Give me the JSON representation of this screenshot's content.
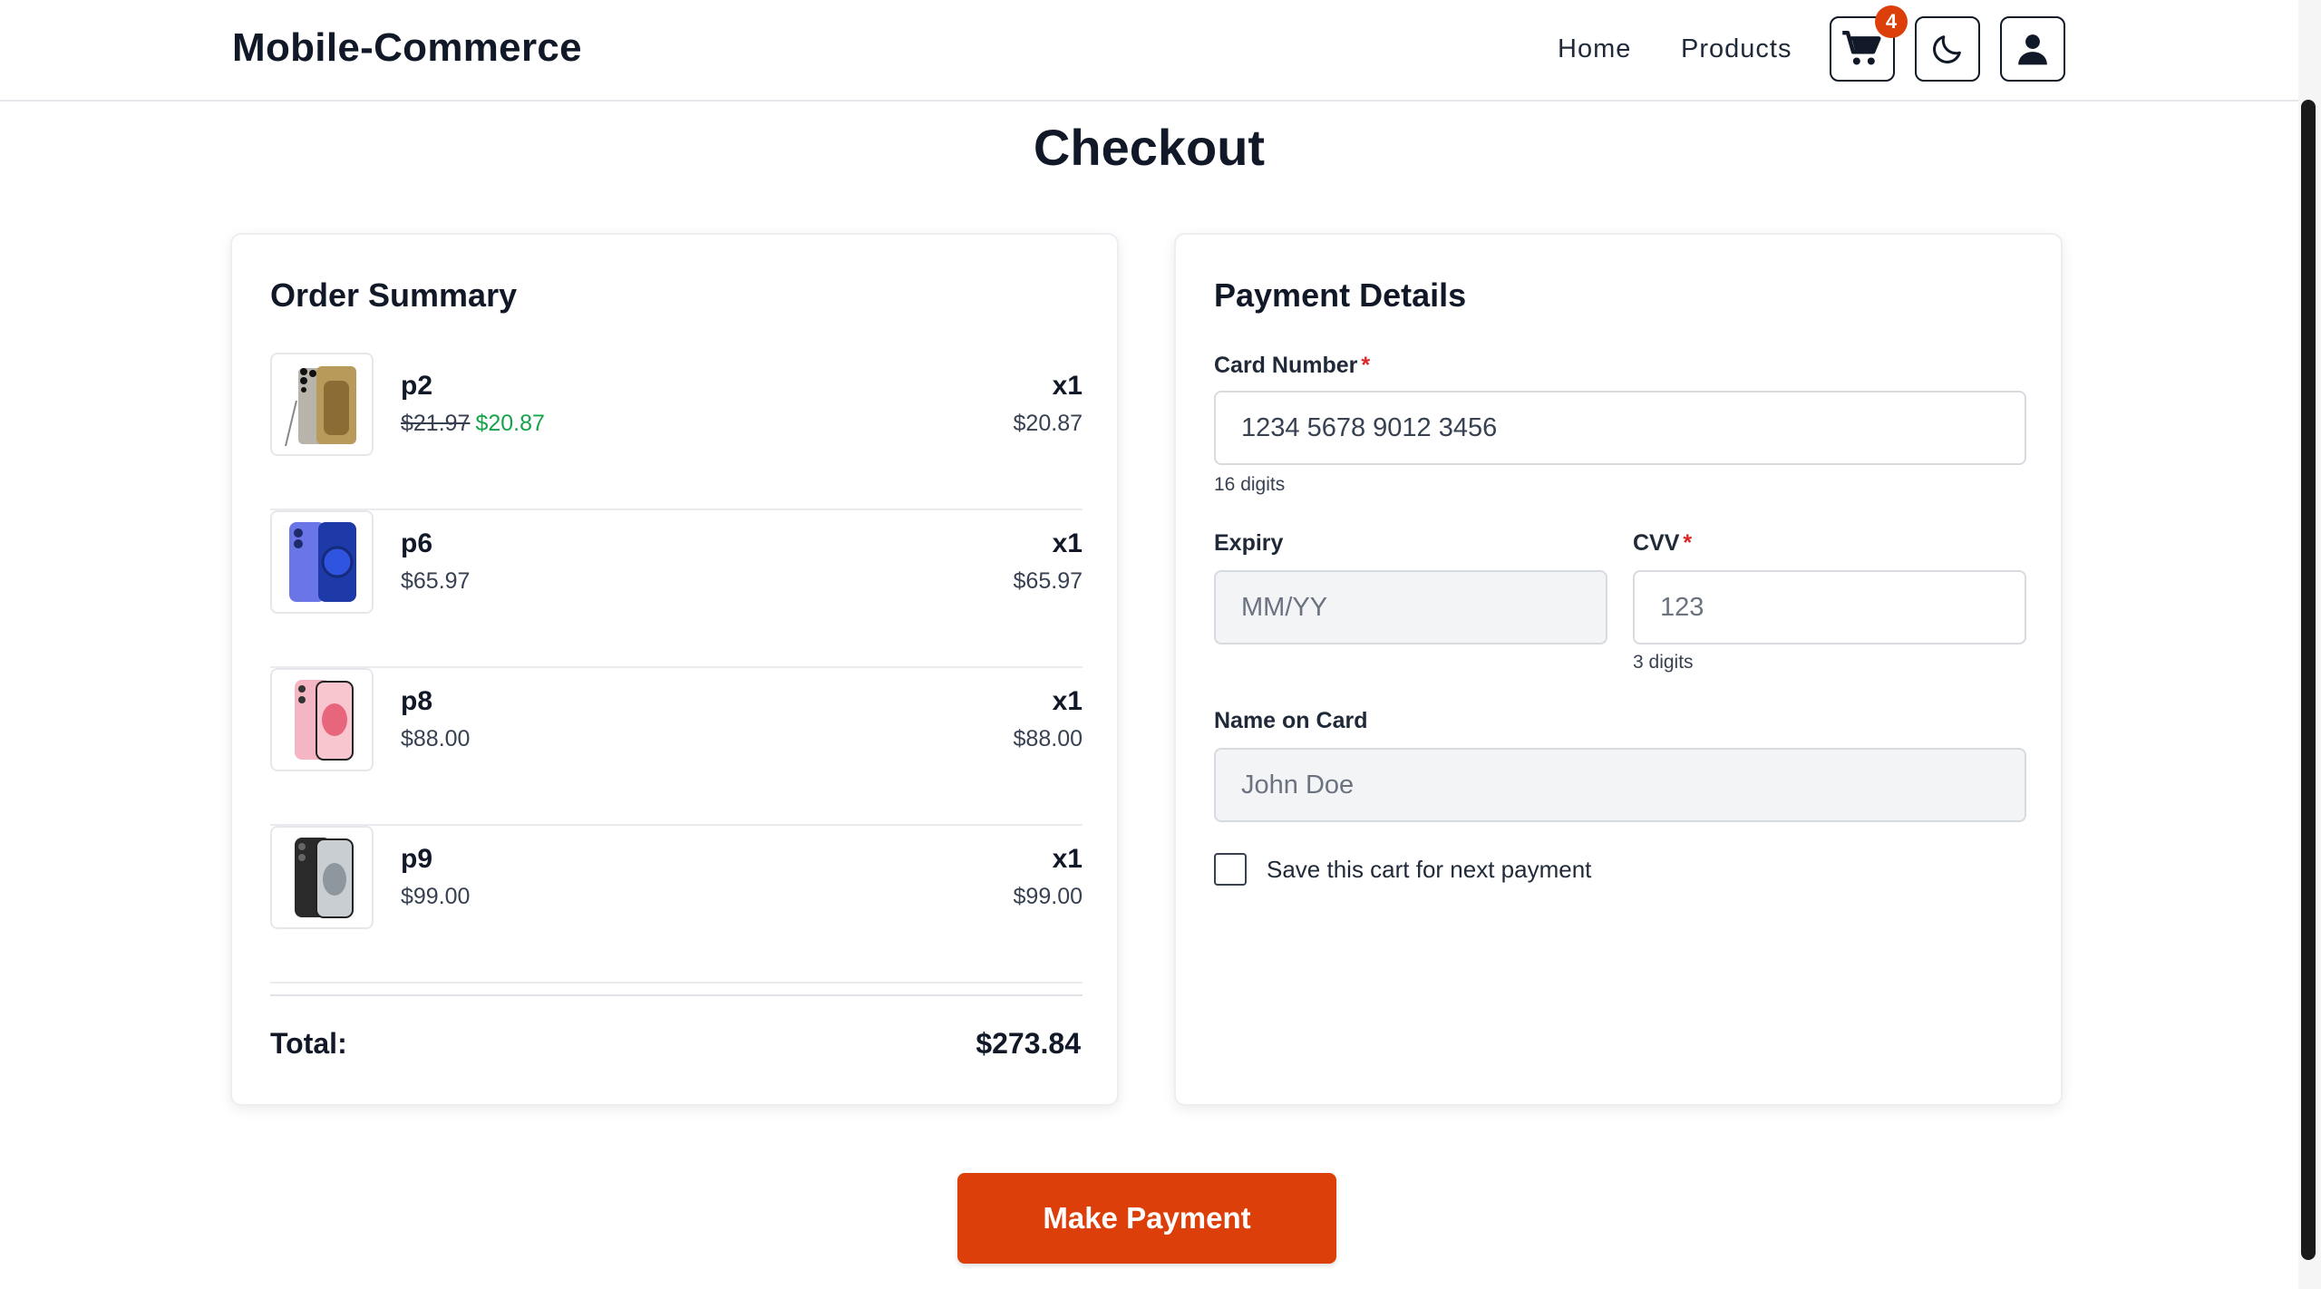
{
  "header": {
    "brand": "Mobile-Commerce",
    "nav": {
      "home": "Home",
      "products": "Products"
    },
    "cart_count": "4",
    "icons": {
      "cart": "cart-icon",
      "theme": "moon-icon",
      "user": "user-icon"
    }
  },
  "page": {
    "title": "Checkout"
  },
  "order_summary": {
    "title": "Order Summary",
    "items": [
      {
        "name": "p2",
        "old_price": "$21.97",
        "price": "$20.87",
        "qty": "x1",
        "subtotal": "$20.87"
      },
      {
        "name": "p6",
        "price": "$65.97",
        "qty": "x1",
        "subtotal": "$65.97"
      },
      {
        "name": "p8",
        "price": "$88.00",
        "qty": "x1",
        "subtotal": "$88.00"
      },
      {
        "name": "p9",
        "price": "$99.00",
        "qty": "x1",
        "subtotal": "$99.00"
      }
    ],
    "total_label": "Total:",
    "total_value": "$273.84"
  },
  "payment": {
    "title": "Payment Details",
    "card_number": {
      "label": "Card Number",
      "required": "*",
      "value": "1234 5678 9012 3456",
      "hint": "16 digits"
    },
    "expiry": {
      "label": "Expiry",
      "placeholder": "MM/YY"
    },
    "cvv": {
      "label": "CVV",
      "required": "*",
      "placeholder": "123",
      "hint": "3 digits"
    },
    "name": {
      "label": "Name on Card",
      "placeholder": "John Doe"
    },
    "save_cart_label": "Save this cart for next payment"
  },
  "actions": {
    "submit": "Make Payment"
  },
  "colors": {
    "accent": "#dc3f0a",
    "discount": "#16a34a",
    "required": "#dc2626"
  }
}
